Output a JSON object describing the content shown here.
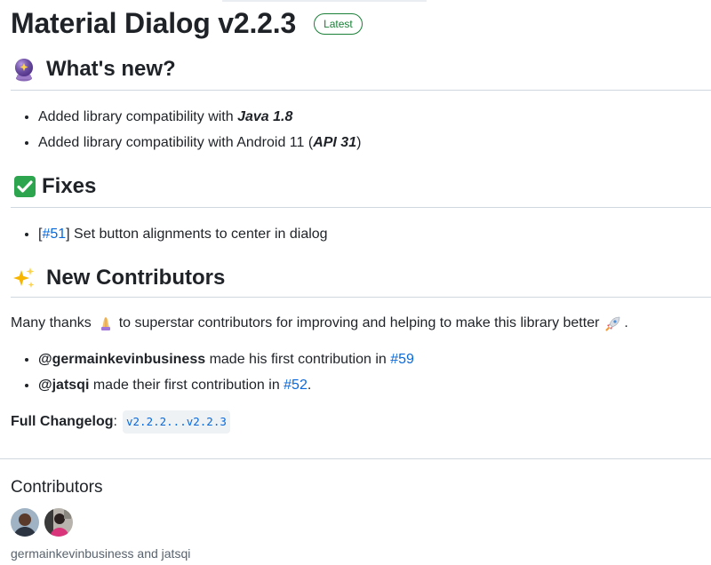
{
  "header": {
    "title": "Material Dialog v2.2.3",
    "badge": "Latest"
  },
  "whats_new": {
    "heading": "What's new?",
    "icon": "crystal-ball-icon",
    "items": [
      {
        "text": "Added library compatibility with ",
        "emphasis": "Java 1.8",
        "suffix": ""
      },
      {
        "text": "Added library compatibility with Android 11 (",
        "emphasis": "API 31",
        "suffix": ")"
      }
    ]
  },
  "fixes": {
    "heading": "Fixes",
    "icon": "check-mark-icon",
    "items": [
      {
        "prefix": "[",
        "link": "#51",
        "text": "] Set button alignments to center in dialog"
      }
    ]
  },
  "new_contributors": {
    "heading": "New Contributors",
    "icon": "sparkles-icon",
    "thanks_before": "Many thanks",
    "thanks_after": "to superstar contributors for improving and helping to make this library better",
    "thanks_end": ".",
    "items": [
      {
        "user": "@germainkevinbusiness",
        "text": " made his first contribution in ",
        "link": "#59",
        "end": ""
      },
      {
        "user": "@jatsqi",
        "text": " made their first contribution in ",
        "link": "#52",
        "end": "."
      }
    ]
  },
  "changelog": {
    "label": "Full Changelog",
    "colon": ":",
    "link": "v2.2.2...v2.2.3"
  },
  "contributors": {
    "title": "Contributors",
    "names": "germainkevinbusiness and jatsqi"
  },
  "colors": {
    "accent": "#0969da",
    "latest": "#1a7f37",
    "check": "#2da44e"
  }
}
